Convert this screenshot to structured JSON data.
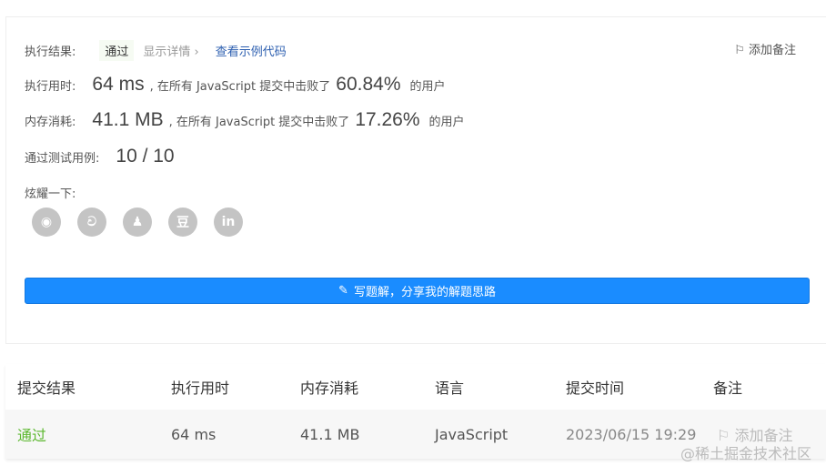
{
  "result": {
    "label": "执行结果:",
    "status": "通过",
    "detail": "显示详情 ›",
    "sample_code": "查看示例代码",
    "add_note": "添加备注"
  },
  "runtime": {
    "label": "执行用时:",
    "value": "64 ms",
    "mid": ", 在所有 JavaScript 提交中击败了",
    "percent": "60.84%",
    "suffix": "的用户"
  },
  "memory": {
    "label": "内存消耗:",
    "value": "41.1 MB",
    "mid": ", 在所有 JavaScript 提交中击败了",
    "percent": "17.26%",
    "suffix": "的用户"
  },
  "tests": {
    "label": "通过测试用例:",
    "value": "10 / 10"
  },
  "share": {
    "label": "炫耀一下:",
    "icons": [
      "wechat-icon",
      "weibo-icon",
      "qq-icon",
      "douban-icon",
      "linkedin-icon"
    ]
  },
  "write_button": "写题解，分享我的解题思路",
  "table": {
    "headers": [
      "提交结果",
      "执行用时",
      "内存消耗",
      "语言",
      "提交时间",
      "备注"
    ],
    "row": {
      "status": "通过",
      "runtime": "64 ms",
      "memory": "41.1 MB",
      "language": "JavaScript",
      "time": "2023/06/15 19:29",
      "note": "添加备注"
    }
  },
  "colors": {
    "pass": "#5cb82f",
    "primary": "#1a8cff",
    "link": "#2d5fb0"
  },
  "watermark": "@稀土掘金技术社区"
}
